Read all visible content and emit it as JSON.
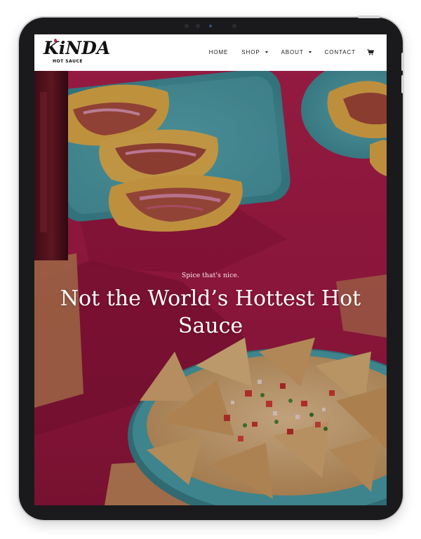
{
  "brand": {
    "logo_text": "KiNDA",
    "logo_subtext": "HOT SAUCE"
  },
  "nav": {
    "items": [
      {
        "label": "HOME",
        "has_dropdown": false
      },
      {
        "label": "SHOP",
        "has_dropdown": true
      },
      {
        "label": "ABOUT",
        "has_dropdown": true
      },
      {
        "label": "CONTACT",
        "has_dropdown": false
      }
    ],
    "cart_icon": "cart-icon"
  },
  "hero": {
    "tagline": "Spice that's nice.",
    "title": "Not the World’s Hottest Hot Sauce"
  },
  "colors": {
    "tablet_frame": "#1a1a1c",
    "table_pink": "#b51b4a",
    "plate_teal": "#3fb3b8",
    "tortilla_yellow": "#f0c64a",
    "nav_text": "#222222",
    "hero_text": "#ffffff"
  }
}
